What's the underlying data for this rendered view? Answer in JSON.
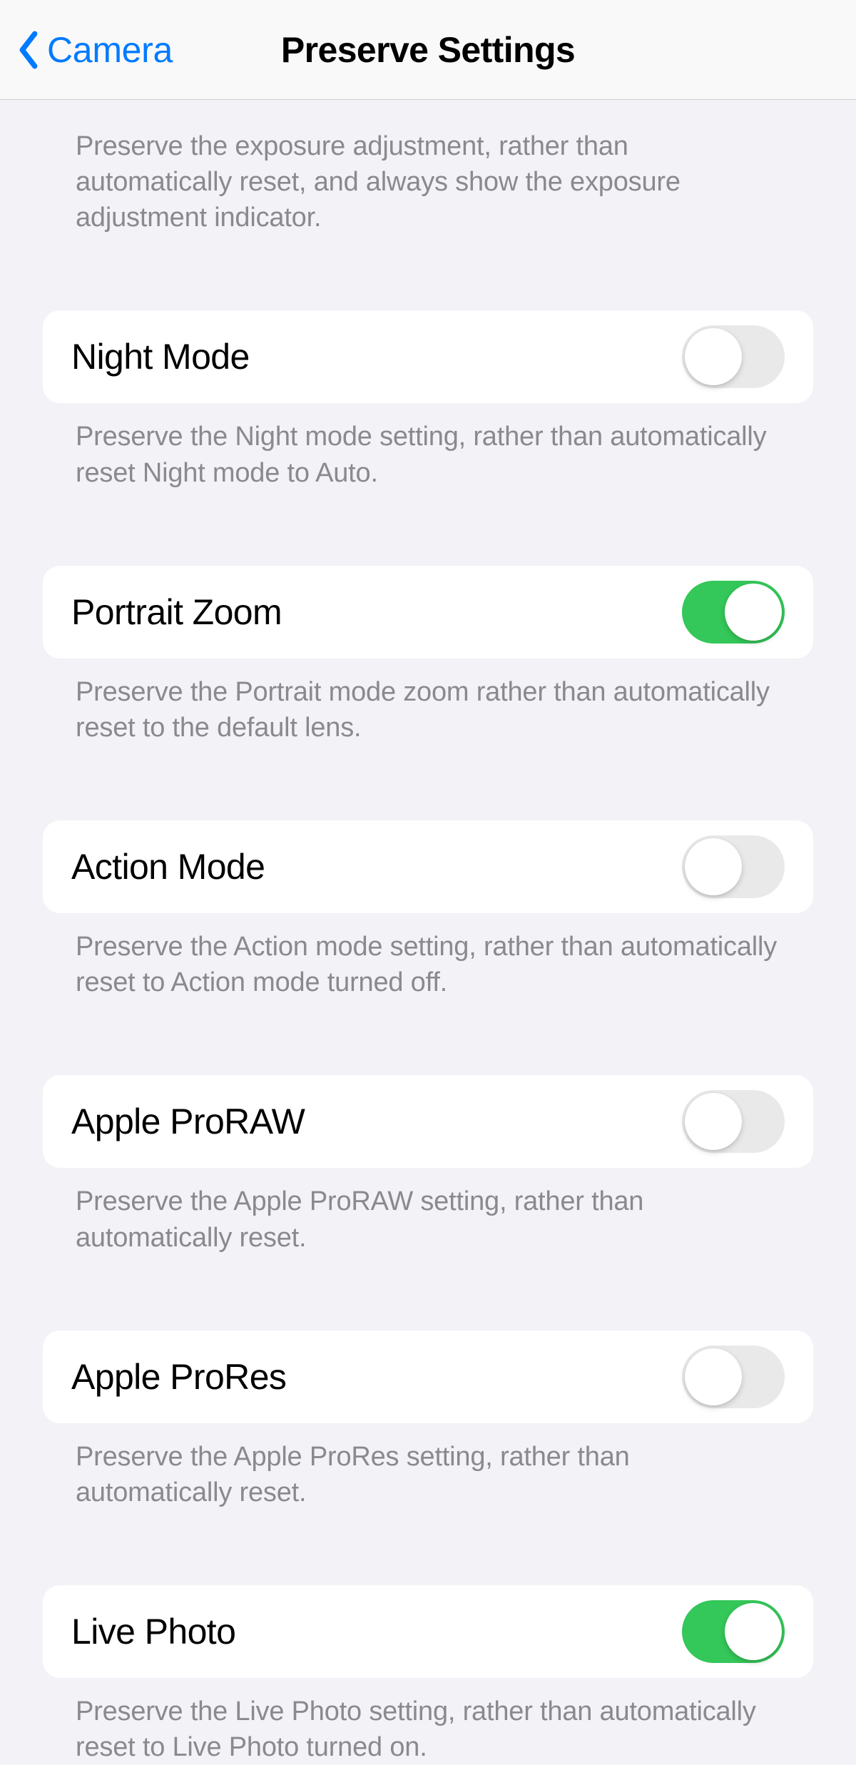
{
  "navbar": {
    "back_label": "Camera",
    "title": "Preserve Settings"
  },
  "intro_note": "Preserve the exposure adjustment, rather than automatically reset, and always show the exposure adjustment indicator.",
  "settings": [
    {
      "label": "Night Mode",
      "enabled": false,
      "note": "Preserve the Night mode setting, rather than automatically reset Night mode to Auto."
    },
    {
      "label": "Portrait Zoom",
      "enabled": true,
      "note": "Preserve the Portrait mode zoom rather than automatically reset to the default lens."
    },
    {
      "label": "Action Mode",
      "enabled": false,
      "note": "Preserve the Action mode setting, rather than automatically reset to Action mode turned off."
    },
    {
      "label": "Apple ProRAW",
      "enabled": false,
      "note": "Preserve the Apple ProRAW setting, rather than automatically reset."
    },
    {
      "label": "Apple ProRes",
      "enabled": false,
      "note": "Preserve the Apple ProRes setting, rather than automatically reset."
    },
    {
      "label": "Live Photo",
      "enabled": true,
      "note": "Preserve the Live Photo setting, rather than automatically reset to Live Photo turned on."
    }
  ]
}
